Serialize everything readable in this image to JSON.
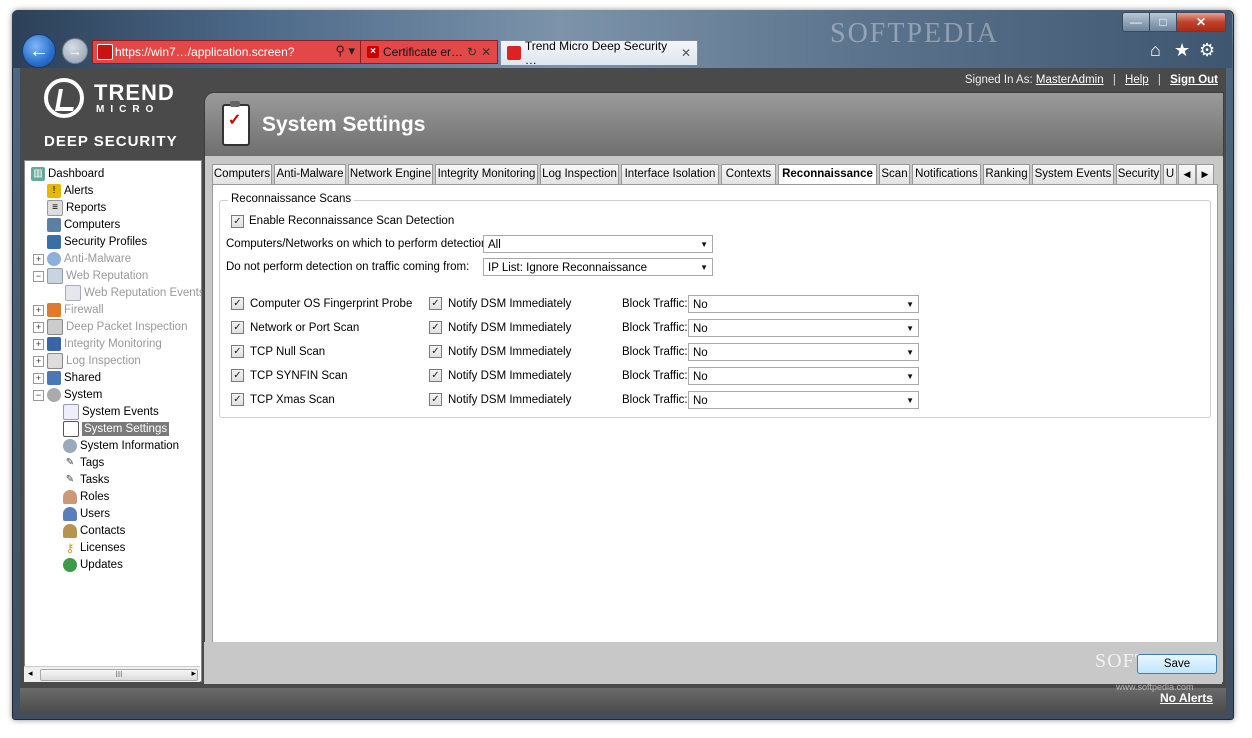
{
  "browser": {
    "address_url": "https://win7…/application.screen?",
    "cert_tab_label": "Certificate er…",
    "active_tab_label": "Trend Micro Deep Security …",
    "watermark": "SOFTPEDIA"
  },
  "brand": {
    "trend": "TREND",
    "micro": "MICRO",
    "product": "DEEP SECURITY"
  },
  "account": {
    "signed_in_prefix": "Signed In As:",
    "user": "MasterAdmin",
    "sep1": "|",
    "help": "Help",
    "sep2": "|",
    "sign_out": "Sign Out"
  },
  "header": {
    "title": "System Settings"
  },
  "sidebar": {
    "items": [
      {
        "label": "Dashboard"
      },
      {
        "label": "Alerts"
      },
      {
        "label": "Reports"
      },
      {
        "label": "Computers"
      },
      {
        "label": "Security Profiles"
      },
      {
        "label": "Anti-Malware"
      },
      {
        "label": "Web Reputation"
      },
      {
        "label": "Web Reputation Events"
      },
      {
        "label": "Firewall"
      },
      {
        "label": "Deep Packet Inspection"
      },
      {
        "label": "Integrity Monitoring"
      },
      {
        "label": "Log Inspection"
      },
      {
        "label": "Shared"
      },
      {
        "label": "System"
      },
      {
        "label": "System Events"
      },
      {
        "label": "System Settings"
      },
      {
        "label": "System Information"
      },
      {
        "label": "Tags"
      },
      {
        "label": "Tasks"
      },
      {
        "label": "Roles"
      },
      {
        "label": "Users"
      },
      {
        "label": "Contacts"
      },
      {
        "label": "Licenses"
      },
      {
        "label": "Updates"
      }
    ],
    "scroll_grip": "III"
  },
  "tabs": [
    {
      "label": "Computers"
    },
    {
      "label": "Anti-Malware"
    },
    {
      "label": "Network Engine"
    },
    {
      "label": "Integrity Monitoring"
    },
    {
      "label": "Log Inspection"
    },
    {
      "label": "Interface Isolation"
    },
    {
      "label": "Contexts"
    },
    {
      "label": "Reconnaissance"
    },
    {
      "label": "Scan"
    },
    {
      "label": "Notifications"
    },
    {
      "label": "Ranking"
    },
    {
      "label": "System Events"
    },
    {
      "label": "Security"
    },
    {
      "label": "U"
    }
  ],
  "recon": {
    "legend": "Reconnaissance Scans",
    "enable_label": "Enable Reconnaissance Scan Detection",
    "enable_checked": true,
    "detect_on_label": "Computers/Networks on which to perform detection:",
    "detect_on_value": "All",
    "exclude_label": "Do not perform detection on traffic coming from:",
    "exclude_value": "IP List: Ignore Reconnaissance",
    "notify_label": "Notify DSM Immediately",
    "block_label": "Block Traffic:",
    "scans": [
      {
        "name": "Computer OS Fingerprint Probe",
        "checked": true,
        "notify": true,
        "block": "No"
      },
      {
        "name": "Network or Port Scan",
        "checked": true,
        "notify": true,
        "block": "No"
      },
      {
        "name": "TCP Null Scan",
        "checked": true,
        "notify": true,
        "block": "No"
      },
      {
        "name": "TCP SYNFIN Scan",
        "checked": true,
        "notify": true,
        "block": "No"
      },
      {
        "name": "TCP Xmas Scan",
        "checked": true,
        "notify": true,
        "block": "No"
      }
    ]
  },
  "footer": {
    "save_label": "Save",
    "no_alerts": "No Alerts",
    "watermark": "SOFTPEDIA",
    "watermark_url": "www.softpedia.com"
  }
}
